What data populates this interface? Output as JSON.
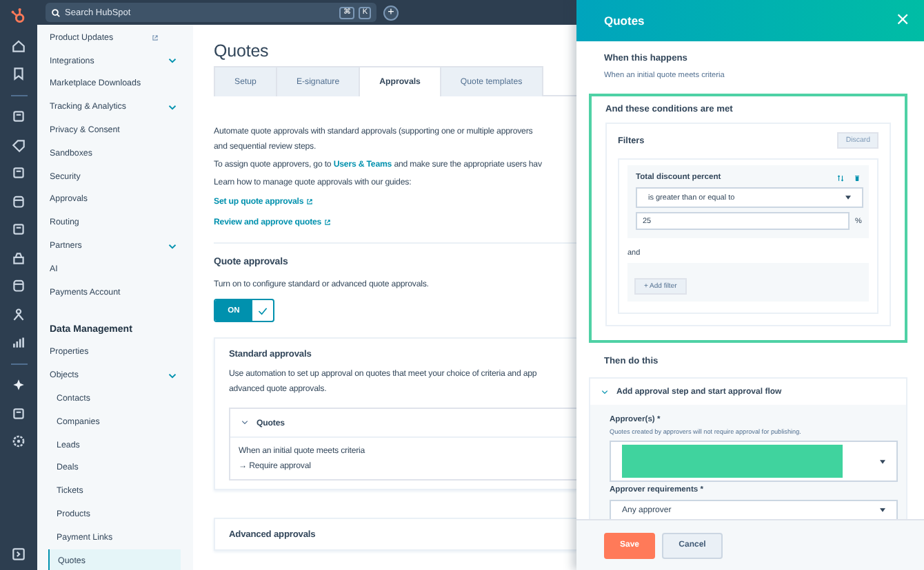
{
  "top_bar": {
    "search": {
      "placeholder": "Search HubSpot"
    },
    "shortcut": [
      "⌘",
      "K"
    ],
    "add_button": "+"
  },
  "sidebar": {
    "items": [
      {
        "label": "Product Updates",
        "kind": "external",
        "selected": false
      },
      {
        "label": "Integrations",
        "kind": "group",
        "selected": false
      },
      {
        "label": "Marketplace Downloads",
        "kind": "link",
        "selected": false
      },
      {
        "label": "Tracking & Analytics",
        "kind": "group",
        "selected": false
      },
      {
        "label": "Privacy & Consent",
        "kind": "link",
        "selected": false
      },
      {
        "label": "Sandboxes",
        "kind": "link",
        "selected": false
      },
      {
        "label": "Security",
        "kind": "link",
        "selected": false
      },
      {
        "label": "Approvals",
        "kind": "link",
        "selected": false
      },
      {
        "label": "Routing",
        "kind": "link",
        "selected": false
      },
      {
        "label": "Partners",
        "kind": "group",
        "selected": false
      },
      {
        "label": "AI",
        "kind": "link",
        "selected": false
      },
      {
        "label": "Payments Account",
        "kind": "link",
        "selected": false
      }
    ],
    "section": "Data Management",
    "section_items": [
      {
        "label": "Properties",
        "kind": "link",
        "selected": false
      },
      {
        "label": "Objects",
        "kind": "group",
        "selected": false,
        "children": [
          {
            "label": "Contacts",
            "selected": false
          },
          {
            "label": "Companies",
            "selected": false
          },
          {
            "label": "Leads",
            "selected": false
          },
          {
            "label": "Deals",
            "selected": false
          },
          {
            "label": "Tickets",
            "selected": false
          },
          {
            "label": "Products",
            "selected": false
          },
          {
            "label": "Payment Links",
            "selected": false
          },
          {
            "label": "Quotes",
            "selected": true
          }
        ]
      }
    ]
  },
  "main": {
    "title": "Quotes",
    "tabs": [
      {
        "label": "Setup",
        "selected": false
      },
      {
        "label": "E-signature",
        "selected": false
      },
      {
        "label": "Approvals",
        "selected": true
      },
      {
        "label": "Quote templates",
        "selected": false
      }
    ],
    "intro": [
      "Automate quote approvals with standard approvals (supporting one or multiple approvers",
      "and sequential review steps."
    ],
    "assign": {
      "before": "To assign quote approvers, go to ",
      "link": "Users & Teams",
      "after": " and make sure the appropriate users hav"
    },
    "guides": "Learn how to manage quote approvals with our guides:",
    "links": [
      "Set up quote approvals",
      "Review and approve quotes"
    ],
    "approvals": {
      "title": "Quote approvals",
      "description": "Turn on to configure standard or advanced quote approvals.",
      "toggle": {
        "label": "ON",
        "on": true
      }
    },
    "standard": {
      "title": "Standard approvals",
      "description": [
        "Use automation to set up approval on quotes that meet your choice of criteria and app",
        "advanced quote approvals."
      ],
      "rule": {
        "title": "Quotes",
        "expanded": true,
        "trigger": "When an initial quote meets criteria",
        "action": "→ Require approval"
      }
    },
    "advanced": {
      "title": "Advanced approvals"
    }
  },
  "panel": {
    "title": "Quotes",
    "close": "×",
    "trigger_heading": "When this happens",
    "trigger": "When an initial quote meets criteria",
    "conditions_heading": "And these conditions are met",
    "filters": {
      "title": "Filters",
      "discard": "Discard",
      "filter": {
        "property": "Total discount percent",
        "operator": "is greater than or equal to",
        "value": "25",
        "unit": "%"
      },
      "joiner": "and",
      "add_filter": "+ Add filter"
    },
    "action_heading": "Then do this",
    "action": {
      "title": "Add approval step and start approval flow",
      "expanded": true,
      "approvers_label": "Approver(s) *",
      "approvers_hint": "Quotes created by approvers will not require approval for publishing.",
      "requirements_label": "Approver requirements *",
      "requirements_value": "Any approver"
    },
    "buttons": [
      {
        "label": "Save",
        "kind": "primary"
      },
      {
        "label": "Cancel",
        "kind": "secondary"
      }
    ]
  }
}
